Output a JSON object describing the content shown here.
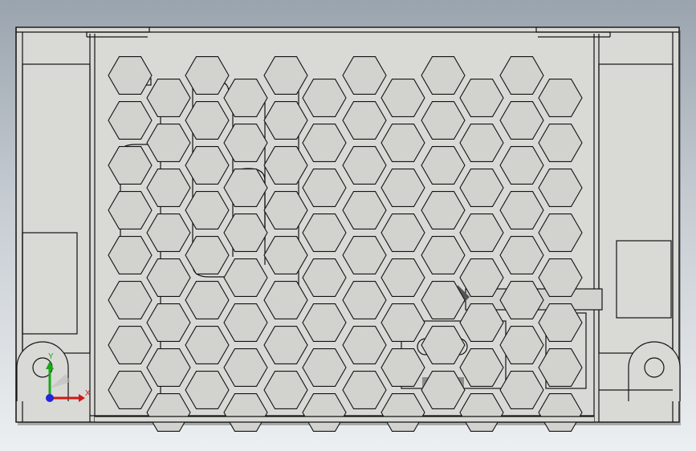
{
  "viewport": {
    "background_top": "#9aa4ae",
    "background_bottom": "#eceff1"
  },
  "model": {
    "part_color": "#d9d9d6",
    "edge_color": "#141414",
    "hole_fill": "#d2d2cf",
    "shadow_color": "#2c2c2c"
  },
  "triad": {
    "x_label": "X",
    "y_label": "Y",
    "x_color": "#d01818",
    "y_color": "#18a818",
    "z_color": "#2424d8"
  }
}
